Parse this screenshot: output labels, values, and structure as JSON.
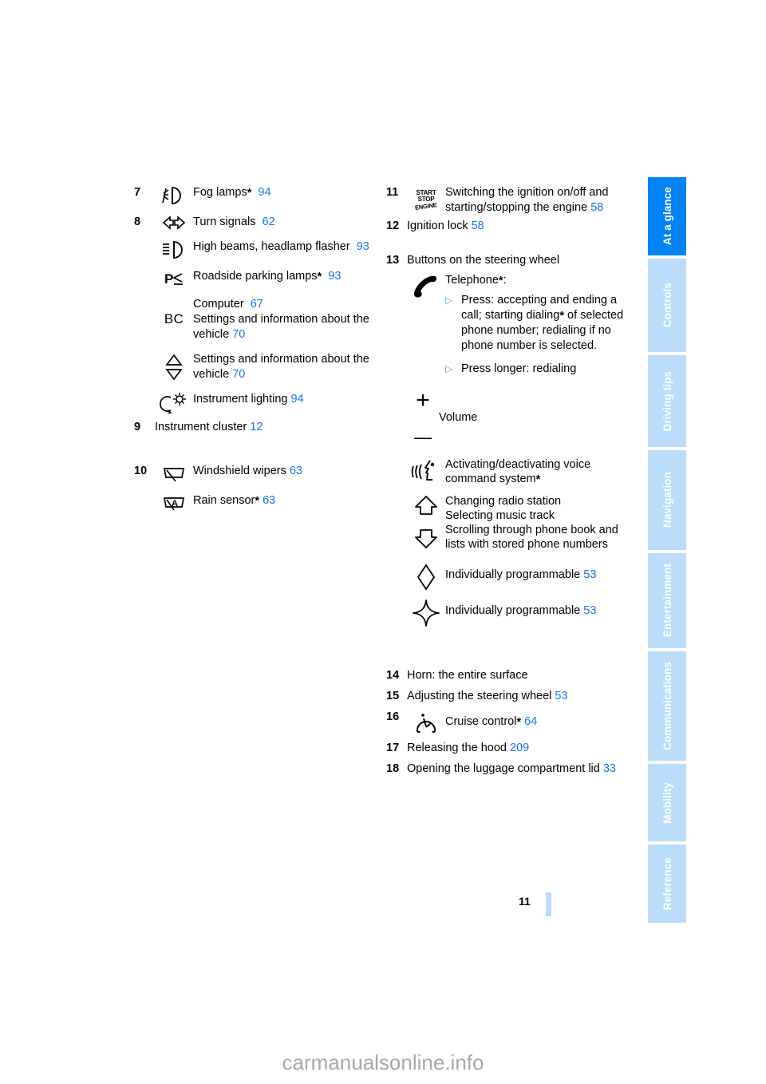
{
  "document": {
    "page_number": "11",
    "watermark": "carmanualsonline.info"
  },
  "sidebar": {
    "items": [
      {
        "label": "At a glance",
        "active": true,
        "icon": "tab-at-a-glance"
      },
      {
        "label": "Controls",
        "active": false,
        "icon": "tab-controls"
      },
      {
        "label": "Driving tips",
        "active": false,
        "icon": "tab-driving-tips"
      },
      {
        "label": "Navigation",
        "active": false,
        "icon": "tab-navigation"
      },
      {
        "label": "Entertainment",
        "active": false,
        "icon": "tab-entertainment"
      },
      {
        "label": "Communications",
        "active": false,
        "icon": "tab-communications"
      },
      {
        "label": "Mobility",
        "active": false,
        "icon": "tab-mobility"
      },
      {
        "label": "Reference",
        "active": false,
        "icon": "tab-reference"
      }
    ]
  },
  "colors": {
    "accent_blue": "#0083f5",
    "tab_light_blue": "#bcdcfb",
    "page_ref_blue": "#1a73f0",
    "bullet_blue": "#49a7f7",
    "watermark_gray": "#a8a8a8"
  },
  "left_column": {
    "item7": {
      "number": "7",
      "icon": "fog-lamps-icon",
      "label": "Fog lamps",
      "asterisk": "*",
      "page": "94"
    },
    "item8": {
      "number": "8",
      "rows": [
        {
          "icon": "turn-signals-icon",
          "label": "Turn signals",
          "asterisk": "",
          "page": "62"
        },
        {
          "icon": "high-beams-icon",
          "label": "High beams, headlamp flasher",
          "asterisk": "",
          "page": "93"
        },
        {
          "icon": "parking-lamps-icon",
          "label": "Roadside parking lamps",
          "asterisk": "*",
          "page": "93"
        }
      ],
      "bc": {
        "icon": "bc-computer-icon",
        "line1_label": "Computer",
        "line1_page": "67",
        "line2_label": "Settings and information about the vehicle",
        "line2_page": "70"
      },
      "arrows": {
        "icon": "up-down-arrows-icon",
        "label": "Settings and information about the vehicle",
        "page": "70"
      },
      "instrument_lighting": {
        "icon": "instrument-lighting-icon",
        "label": "Instrument lighting",
        "page": "94"
      }
    },
    "item9": {
      "number": "9",
      "label": "Instrument cluster",
      "page": "12"
    },
    "item10": {
      "number": "10",
      "rows": [
        {
          "icon": "windshield-wipers-icon",
          "label": "Windshield wipers",
          "asterisk": "",
          "page": "63"
        },
        {
          "icon": "rain-sensor-icon",
          "label": "Rain sensor",
          "asterisk": "*",
          "page": "63"
        }
      ]
    }
  },
  "right_column": {
    "item11": {
      "number": "11",
      "icon": "start-stop-engine-icon",
      "icon_text": {
        "line1": "START",
        "line2": "STOP",
        "line3": "ENGINE"
      },
      "label": "Switching the ignition on/off and starting/stopping the engine",
      "page": "58"
    },
    "item12": {
      "number": "12",
      "label": "Ignition lock",
      "page": "58"
    },
    "item13": {
      "number": "13",
      "label": "Buttons on the steering wheel",
      "telephone": {
        "icon": "telephone-handset-icon",
        "label": "Telephone",
        "asterisk": "*",
        "colon": ":",
        "bullets": [
          {
            "mark": "▷",
            "text_parts": [
              "Press: accepting and ending a call; starting dialing",
              "*",
              " of selected phone number; redialing if no phone number is selected."
            ]
          },
          {
            "mark": "▷",
            "text_parts": [
              "Press longer: redialing",
              "",
              ""
            ]
          }
        ]
      },
      "volume": {
        "icon": "plus-minus-icon",
        "plus": "+",
        "minus": "—",
        "label": "Volume"
      },
      "voice": {
        "icon": "voice-command-icon",
        "label": "Activating/deactivating voice command system",
        "asterisk": "*"
      },
      "arrows": {
        "icon_up": "arrow-up-icon",
        "icon_down": "arrow-down-icon",
        "lines": [
          "Changing radio station",
          "Selecting music track",
          "Scrolling through phone book and",
          "lists with stored phone numbers"
        ]
      },
      "programmable1": {
        "icon": "diamond-icon",
        "label": "Individually programmable",
        "page": "53"
      },
      "programmable2": {
        "icon": "four-point-star-icon",
        "label": "Individually programmable",
        "page": "53"
      }
    },
    "item14": {
      "number": "14",
      "label": "Horn: the entire surface",
      "page": ""
    },
    "item15": {
      "number": "15",
      "label": "Adjusting the steering wheel",
      "page": "53"
    },
    "item16": {
      "number": "16",
      "icon": "cruise-control-icon",
      "label": "Cruise control",
      "asterisk": "*",
      "page": "64"
    },
    "item17": {
      "number": "17",
      "label": "Releasing the hood",
      "page": "209"
    },
    "item18": {
      "number": "18",
      "label": "Opening the luggage compartment lid",
      "page": "33"
    }
  }
}
